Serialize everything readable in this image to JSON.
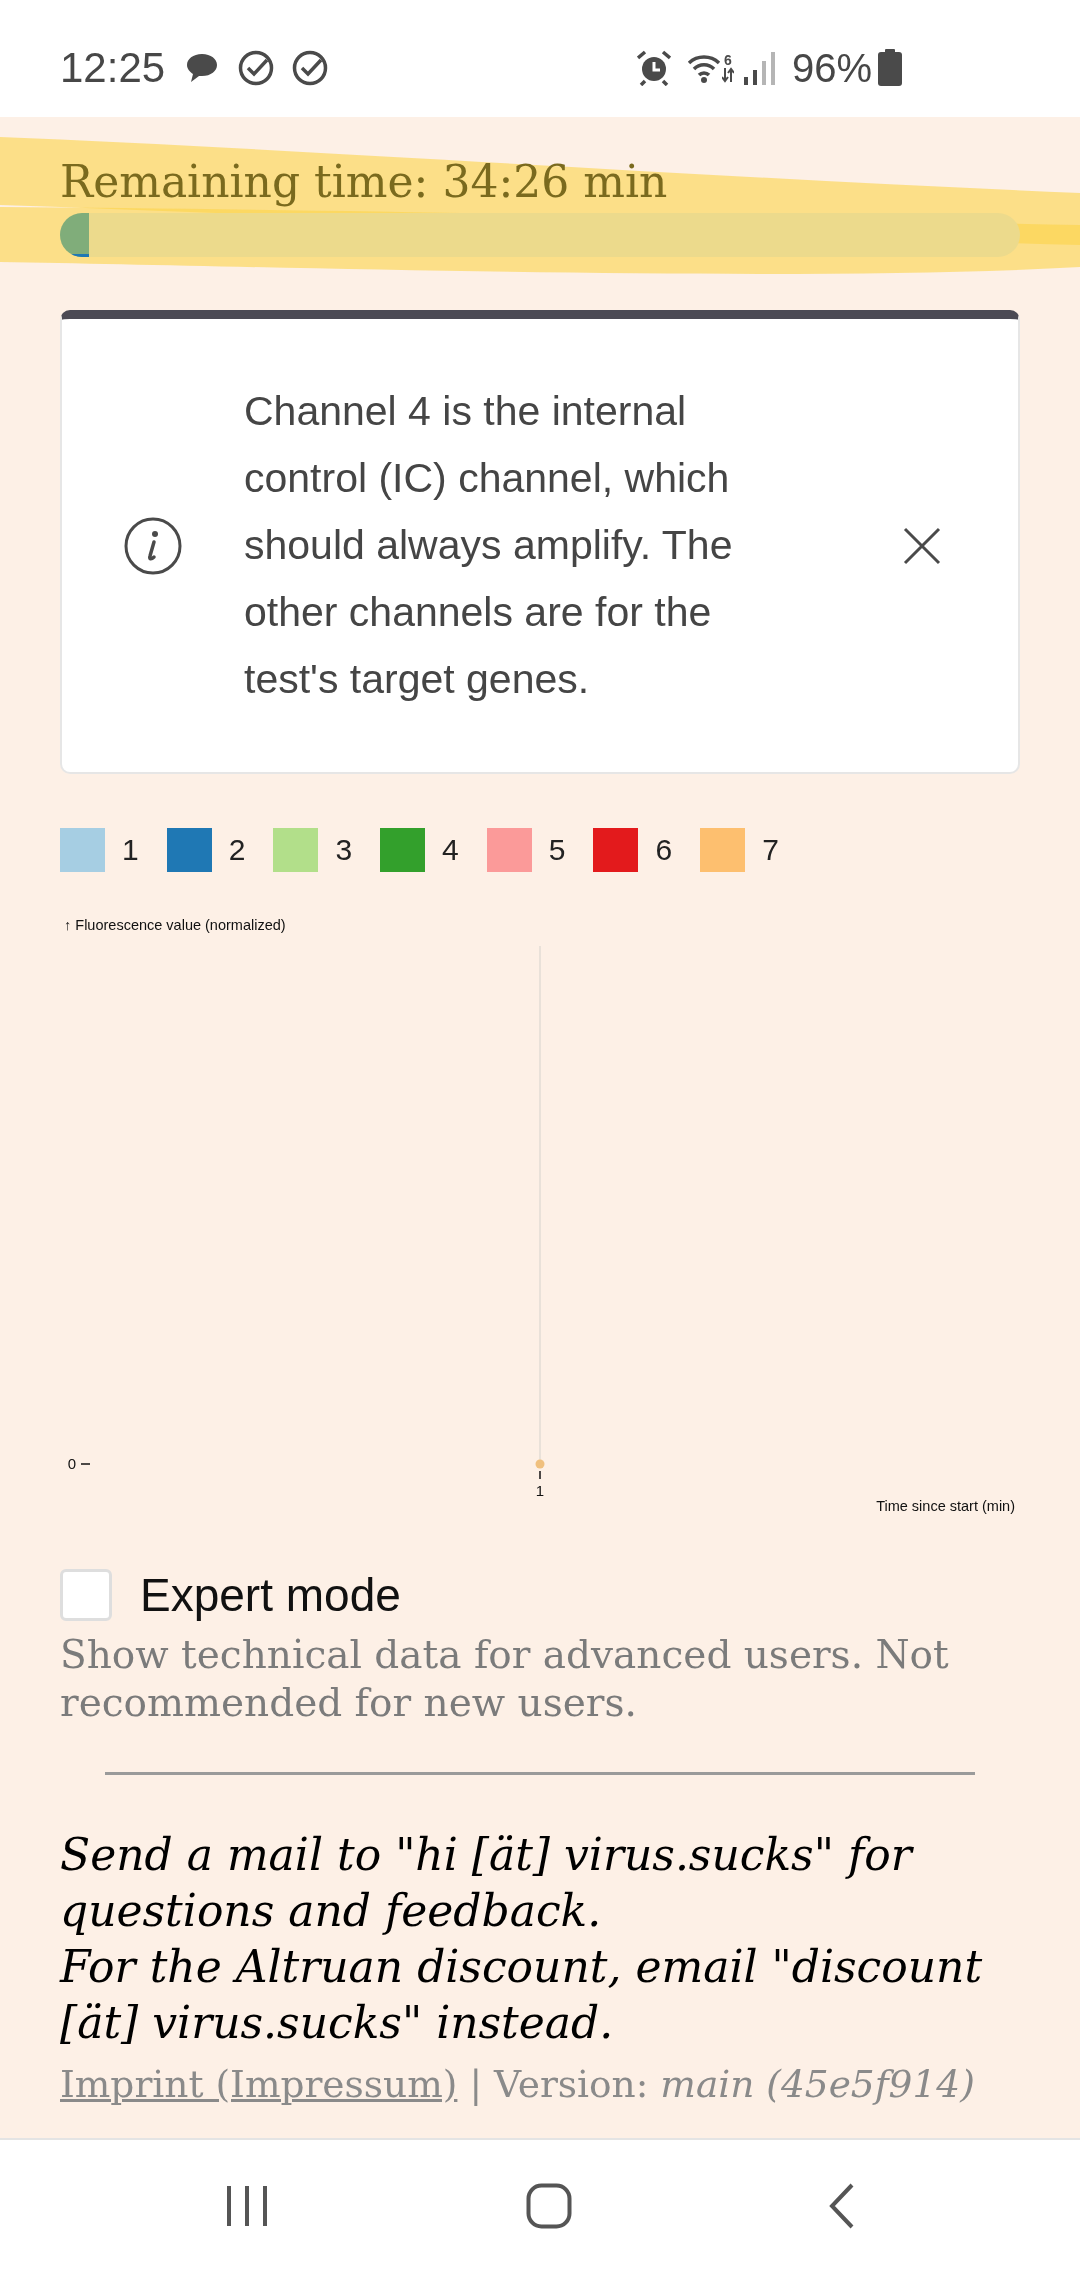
{
  "status_bar": {
    "time": "12:25",
    "wifi_label": "6",
    "battery": "96%"
  },
  "timer": {
    "label": "Remaining time: 34:26 min",
    "level": 0.03
  },
  "notice": {
    "text": "Channel 4 is the internal control (IC) channel, which should always amplify. The other channels are for the test's target genes."
  },
  "chart": {
    "legend": [
      {
        "label": "1",
        "color": "#a6cee3"
      },
      {
        "label": "2",
        "color": "#1f78b4"
      },
      {
        "label": "3",
        "color": "#b2df8a"
      },
      {
        "label": "4",
        "color": "#33a02c"
      },
      {
        "label": "5",
        "color": "#fb9a99"
      },
      {
        "label": "6",
        "color": "#e31a1c"
      },
      {
        "label": "7",
        "color": "#fdbf6f"
      }
    ],
    "y_title": "↑ Fluorescence value (normalized)",
    "y_tick": "0",
    "x_tick": "1",
    "x_title": "Time since start (min)"
  },
  "expert_mode": {
    "label": "Expert mode",
    "checked": false,
    "description": "Show technical data for advanced users. Not recommended for new users."
  },
  "contact": [
    "Send a mail to \"hi [ät] virus.sucks\" for questions and feedback.",
    "For the Altruan discount, email \"discount [ät] virus.sucks\" instead."
  ],
  "footer": {
    "imprint_link": "Imprint (Impressum)",
    "separator": "|",
    "version": "Version: *main (45e5f914)*"
  }
}
